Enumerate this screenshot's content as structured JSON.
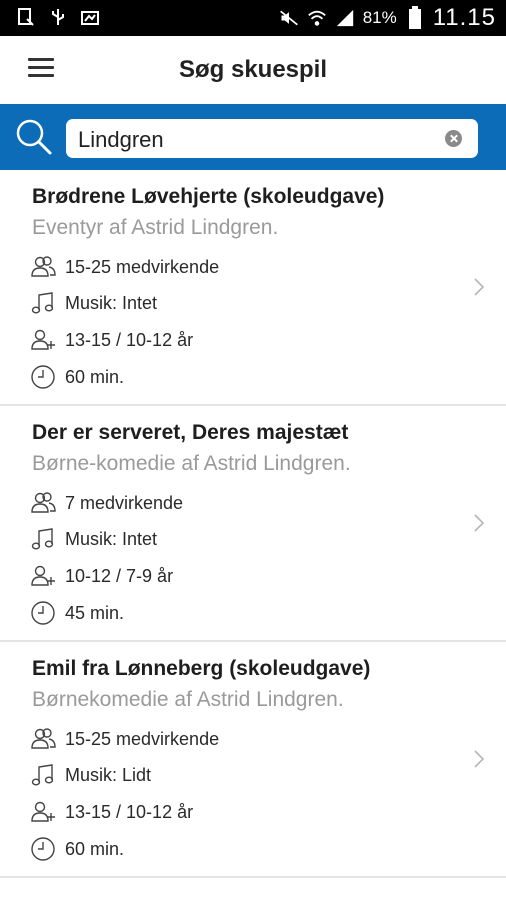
{
  "status_bar": {
    "battery_percent": "81%",
    "time": "11.15"
  },
  "app_bar": {
    "title": "Søg skuespil"
  },
  "search": {
    "value": "Lindgren"
  },
  "results": [
    {
      "title": "Brødrene Løvehjerte (skoleudgave)",
      "subtitle": "Eventyr af Astrid Lindgren.",
      "cast": "15-25 medvirkende",
      "music": "Musik: Intet",
      "age": "13-15 / 10-12 år",
      "duration": "60 min."
    },
    {
      "title": "Der er serveret, Deres majestæt",
      "subtitle": "Børne-komedie af Astrid Lindgren.",
      "cast": "7 medvirkende",
      "music": "Musik: Intet",
      "age": "10-12 / 7-9 år",
      "duration": "45 min."
    },
    {
      "title": "Emil fra Lønneberg (skoleudgave)",
      "subtitle": "Børnekomedie af Astrid Lindgren.",
      "cast": "15-25 medvirkende",
      "music": "Musik: Lidt",
      "age": "13-15 / 10-12 år",
      "duration": "60 min."
    }
  ],
  "colors": {
    "search_bar_bg": "#0d6cb7",
    "status_bar_bg": "#000000"
  },
  "icons": {
    "cast": "people-icon",
    "music": "music-note-icon",
    "age": "add-person-icon",
    "duration": "clock-icon",
    "open": "chevron-right-icon"
  }
}
